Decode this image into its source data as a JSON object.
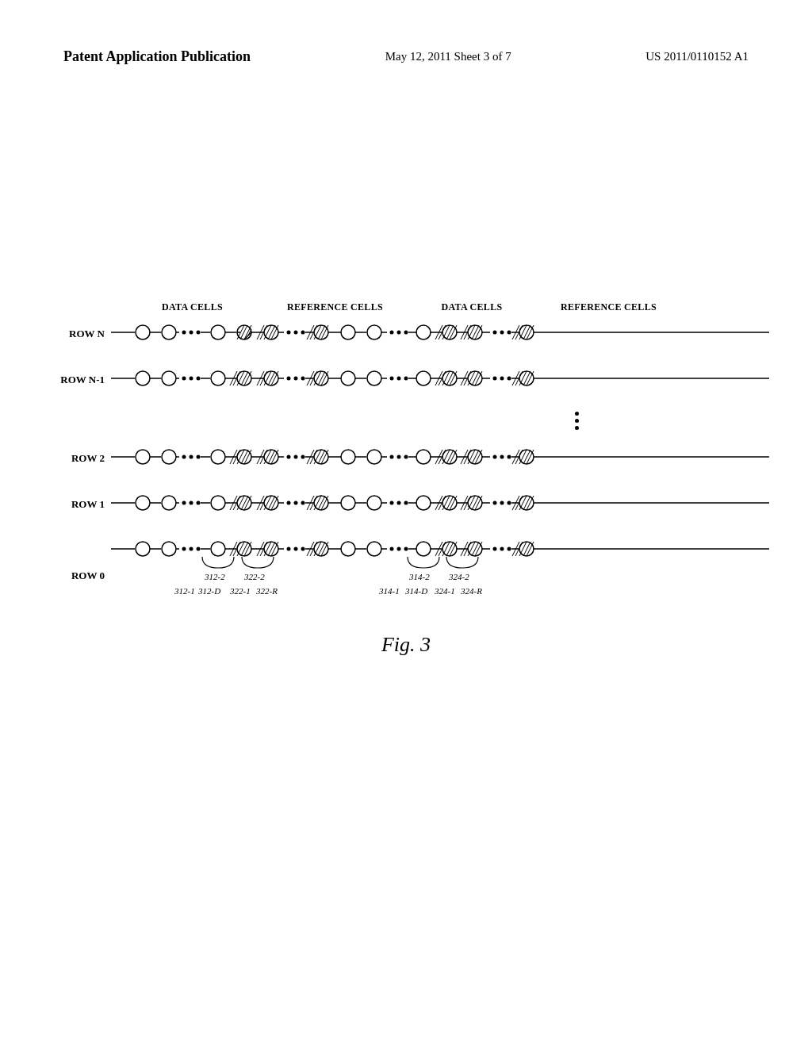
{
  "header": {
    "left": "Patent Application Publication",
    "center": "May 12, 2011  Sheet 3 of 7",
    "right": "US 2011/0110152 A1"
  },
  "column_labels": {
    "data_cells_1": "DATA CELLS",
    "reference_cells_1": "REFERENCE CELLS",
    "data_cells_2": "DATA CELLS",
    "reference_cells_2": "REFERENCE CELLS"
  },
  "rows": [
    {
      "label": "ROW N"
    },
    {
      "label": "ROW N-1"
    },
    {
      "label": "ROW 2"
    },
    {
      "label": "ROW 1"
    },
    {
      "label": "ROW 0"
    }
  ],
  "bottom_labels": [
    "312-1",
    "312-D",
    "322-1",
    "322-R",
    "314-1",
    "314-D",
    "324-1",
    "324-R"
  ],
  "bracket_labels": [
    "312-2",
    "322-2",
    "314-2",
    "324-2"
  ],
  "figure_caption": "Fig. 3"
}
